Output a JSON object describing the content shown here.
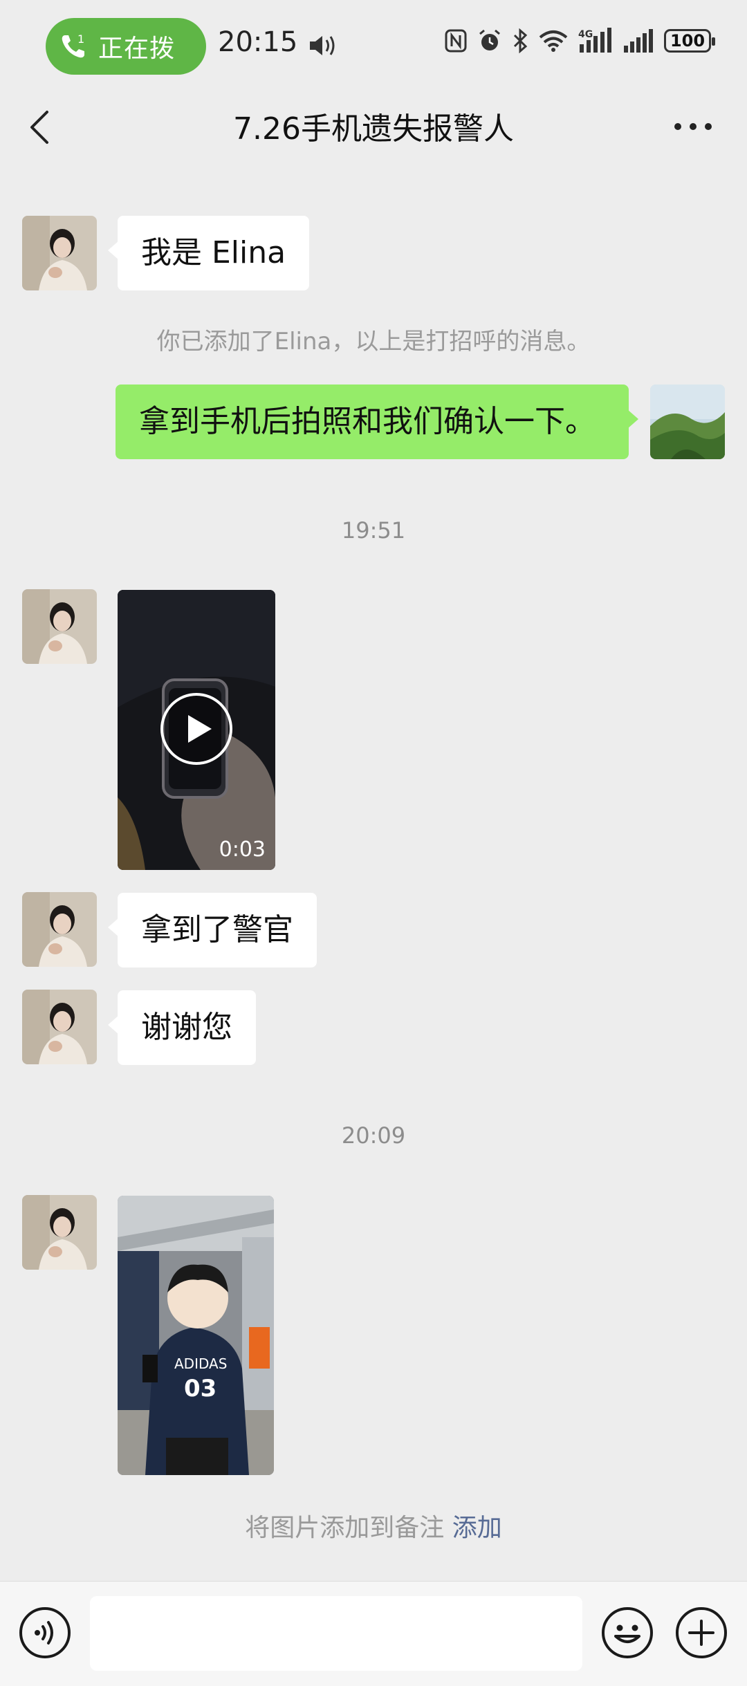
{
  "status_bar": {
    "call_label": "正在拨",
    "call_badge": "1",
    "time": "20:15",
    "battery": "100",
    "network": "4G"
  },
  "header": {
    "title": "7.26手机遗失报警人"
  },
  "messages": {
    "m1_text": "我是 Elina",
    "system_added": "你已添加了Elina，以上是打招呼的消息。",
    "m2_text": "拿到手机后拍照和我们确认一下。",
    "time1": "19:51",
    "video_duration": "0:03",
    "m4_text": "拿到了警官",
    "m5_text": "谢谢您",
    "time2": "20:09",
    "photo_shirt_brand": "ADIDAS",
    "photo_shirt_number": "03"
  },
  "note": {
    "text": "将图片添加到备注",
    "link": "添加"
  },
  "colors": {
    "background": "#ededed",
    "sent_bubble": "#95ec69",
    "call_pill": "#5fb646",
    "link": "#576b95"
  }
}
